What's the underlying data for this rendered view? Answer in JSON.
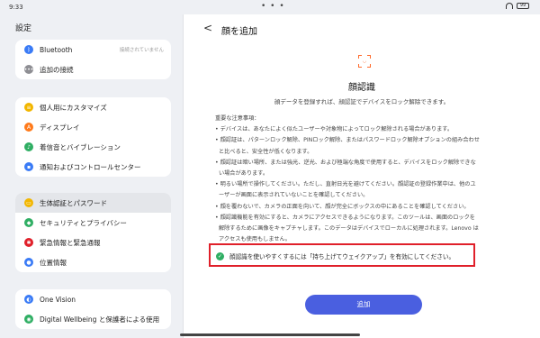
{
  "status": {
    "time": "9:33",
    "dots": "• • •",
    "battery": "99"
  },
  "sidebar": {
    "title": "設定",
    "group1": [
      {
        "label": "Bluetooth",
        "sub": "接続されていません",
        "icon": "bluetooth-icon",
        "color": "#3a7bf6"
      },
      {
        "label": "追加の接続",
        "icon": "more-connections-icon",
        "color": "#8e8e93"
      }
    ],
    "group2": [
      {
        "label": "個人用にカスタマイズ",
        "icon": "personalize-icon",
        "color": "#f2b600"
      },
      {
        "label": "ディスプレイ",
        "icon": "display-icon",
        "color": "#ff7a1a"
      },
      {
        "label": "着信音とバイブレーション",
        "icon": "sound-icon",
        "color": "#2fae63"
      },
      {
        "label": "通知およびコントロールセンター",
        "icon": "notifications-icon",
        "color": "#3a7bf6"
      }
    ],
    "group3": [
      {
        "label": "生体認証とパスワード",
        "icon": "biometrics-icon",
        "color": "#f2b600",
        "selected": true
      },
      {
        "label": "セキュリティとプライバシー",
        "icon": "security-icon",
        "color": "#2fae63"
      },
      {
        "label": "緊急情報と緊急通報",
        "icon": "emergency-icon",
        "color": "#e0202a"
      },
      {
        "label": "位置情報",
        "icon": "location-icon",
        "color": "#3a7bf6"
      }
    ],
    "group4": [
      {
        "label": "One Vision",
        "icon": "one-vision-icon",
        "color": "#3a7bf6"
      },
      {
        "label": "Digital Wellbeing と保護者による使用",
        "icon": "wellbeing-icon",
        "color": "#2fae63"
      }
    ]
  },
  "content": {
    "back_glyph": "<",
    "title": "顔を追加",
    "feature_title": "顔認識",
    "feature_desc": "顔データを登録すれば、顔認証でデバイスをロック解除できます。",
    "notes": [
      "重要な注意事項：",
      "• デバイスは、あなたによく似たユーザーや対象物によってロック解除される場合があります。",
      "• 顔認証は、パターンロック解除、PINロック解除、またはパスワードロック解除オプションの組み合わせ",
      "  と比べると、安全性が低くなります。",
      "• 顔認証は暗い場所、または強光、逆光、および極端な角度で使用すると、デバイスをロック解除できな",
      "  い場合があります。",
      "• 明るい場所で操作してください。ただし、直射日光を避けてください。顔認証の登録作業中は、他のユ",
      "  ーザーが画面に表示されていないことを確認してください。",
      "• 顔を覆わないで、カメラの正面を向いて、顔が完全にボックスの中にあることを確認してください。",
      "• 顔認識機能を有効にすると、カメラにアクセスできるようになります。このツールは、画面のロックを",
      "  解除するために画像をキャプチャします。このデータはデバイスでローカルに処理されます。Lenovo は",
      "  アクセスも使用もしません。"
    ],
    "tip": "顔認識を使いやすくするには「持ち上げてウェイクアップ」を有効にしてください。",
    "add_button": "追加"
  }
}
